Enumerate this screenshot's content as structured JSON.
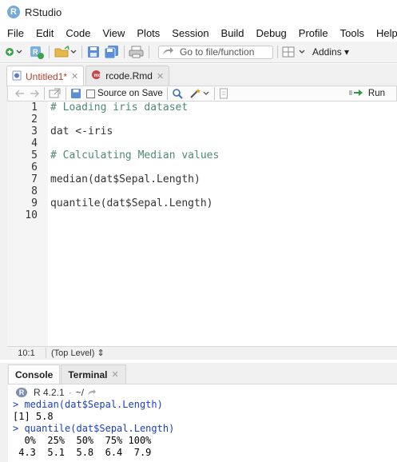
{
  "app": {
    "title": "RStudio",
    "logo_letter": "R"
  },
  "menu": [
    "File",
    "Edit",
    "Code",
    "View",
    "Plots",
    "Session",
    "Build",
    "Debug",
    "Profile",
    "Tools",
    "Help"
  ],
  "toolbar": {
    "goto_placeholder": "Go to file/function",
    "addins_label": "Addins"
  },
  "editor_tabs": [
    {
      "label": "Untitled1*",
      "active": true
    },
    {
      "label": "rcode.Rmd",
      "active": false
    }
  ],
  "editor_toolbar": {
    "source_on_save_label": "Source on Save",
    "run_label": "Run"
  },
  "editor": {
    "line_numbers": [
      "1",
      "2",
      "3",
      "4",
      "5",
      "6",
      "7",
      "8",
      "9",
      "10"
    ],
    "lines": [
      {
        "text": "# Loading iris dataset",
        "kind": "comment"
      },
      {
        "text": "",
        "kind": "code"
      },
      {
        "text": "dat <-iris",
        "kind": "code"
      },
      {
        "text": "",
        "kind": "code"
      },
      {
        "text": "# Calculating Median values",
        "kind": "comment"
      },
      {
        "text": "",
        "kind": "code"
      },
      {
        "text": "median(dat$Sepal.Length)",
        "kind": "code"
      },
      {
        "text": "",
        "kind": "code"
      },
      {
        "text": "quantile(dat$Sepal.Length)",
        "kind": "code"
      },
      {
        "text": "",
        "kind": "code"
      }
    ]
  },
  "status": {
    "cursor_pos": "10:1",
    "scope": "(Top Level)"
  },
  "console_tabs": [
    {
      "label": "Console",
      "active": true
    },
    {
      "label": "Terminal",
      "active": false
    }
  ],
  "console_header": {
    "r_version": "R 4.2.1",
    "path": "~/"
  },
  "console_lines": [
    {
      "text": "> median(dat$Sepal.Length)",
      "kind": "input"
    },
    {
      "text": "[1] 5.8",
      "kind": "output"
    },
    {
      "text": "> quantile(dat$Sepal.Length)",
      "kind": "input"
    },
    {
      "text": "  0%  25%  50%  75% 100%",
      "kind": "output"
    },
    {
      "text": " 4.3  5.1  5.8  6.4  7.9",
      "kind": "output"
    }
  ],
  "colors": {
    "comment": "#4d8a72",
    "console_input": "#1a3ec4",
    "accent_blue": "#75aadb",
    "run_green": "#2e9a3e"
  }
}
